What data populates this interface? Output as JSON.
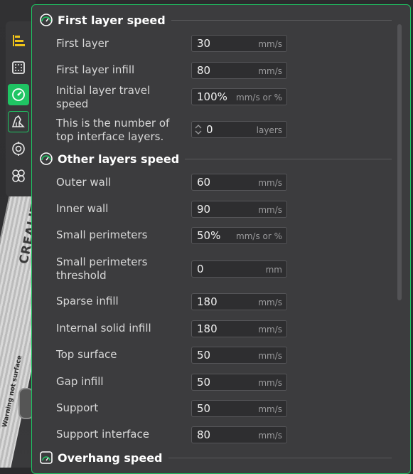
{
  "colors": {
    "accent": "#1fc463",
    "panel": "#3c3c3e",
    "field": "#2e2e30"
  },
  "viewport": {
    "brand": "CREALITY",
    "plate_note": "Warning not surface"
  },
  "toolbar": {
    "items": [
      {
        "name": "align-icon"
      },
      {
        "name": "frame-icon"
      },
      {
        "name": "speed-icon"
      },
      {
        "name": "support-icon"
      },
      {
        "name": "target-icon"
      },
      {
        "name": "flower-icon"
      }
    ]
  },
  "sections": {
    "first_layer": {
      "title": "First layer speed",
      "icon": "speedometer-icon"
    },
    "other_layers": {
      "title": "Other layers speed",
      "icon": "speedometer-icon"
    },
    "overhang": {
      "title": "Overhang speed",
      "icon": "overhang-icon"
    }
  },
  "first_layer": {
    "first_layer": {
      "label": "First layer",
      "value": "30",
      "unit": "mm/s"
    },
    "first_layer_infill": {
      "label": "First layer infill",
      "value": "80",
      "unit": "mm/s"
    },
    "initial_travel": {
      "label_line1": "Initial layer travel",
      "label_line2": "speed",
      "value": "100%",
      "unit": "mm/s or %"
    },
    "top_interface": {
      "label_line1": "This is the number of",
      "label_line2": "top interface layers.",
      "value": "0",
      "unit": "layers"
    }
  },
  "other_layers": {
    "outer_wall": {
      "label": "Outer wall",
      "value": "60",
      "unit": "mm/s"
    },
    "inner_wall": {
      "label": "Inner wall",
      "value": "90",
      "unit": "mm/s"
    },
    "small_perimeters": {
      "label": "Small perimeters",
      "value": "50%",
      "unit": "mm/s or %"
    },
    "small_perimeters_threshold": {
      "label_line1": "Small perimeters",
      "label_line2": "threshold",
      "value": "0",
      "unit": "mm"
    },
    "sparse_infill": {
      "label": "Sparse infill",
      "value": "180",
      "unit": "mm/s"
    },
    "internal_solid_infill": {
      "label": "Internal solid infill",
      "value": "180",
      "unit": "mm/s"
    },
    "top_surface": {
      "label": "Top surface",
      "value": "50",
      "unit": "mm/s"
    },
    "gap_infill": {
      "label": "Gap infill",
      "value": "50",
      "unit": "mm/s"
    },
    "support": {
      "label": "Support",
      "value": "50",
      "unit": "mm/s"
    },
    "support_interface": {
      "label": "Support interface",
      "value": "80",
      "unit": "mm/s"
    }
  }
}
